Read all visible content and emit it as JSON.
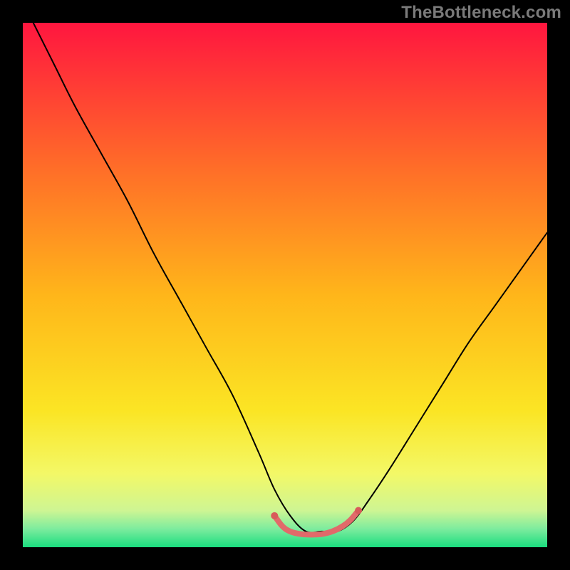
{
  "watermark": "TheBottleneck.com",
  "chart_data": {
    "type": "line",
    "title": "",
    "xlabel": "",
    "ylabel": "",
    "xlim": [
      0,
      100
    ],
    "ylim": [
      0,
      100
    ],
    "grid": false,
    "legend": false,
    "background_gradient": {
      "type": "linear-vertical",
      "stops": [
        {
          "pos": 0.0,
          "color": "#ff163f"
        },
        {
          "pos": 0.28,
          "color": "#ff6e28"
        },
        {
          "pos": 0.52,
          "color": "#ffb61a"
        },
        {
          "pos": 0.74,
          "color": "#fbe524"
        },
        {
          "pos": 0.86,
          "color": "#f3f867"
        },
        {
          "pos": 0.93,
          "color": "#cef593"
        },
        {
          "pos": 0.965,
          "color": "#7dec9e"
        },
        {
          "pos": 1.0,
          "color": "#1add7f"
        }
      ]
    },
    "series": [
      {
        "name": "curve",
        "stroke": "#000000",
        "stroke_width": 2,
        "fill": null,
        "x": [
          2,
          6,
          10,
          15,
          20,
          25,
          30,
          35,
          40,
          45,
          48,
          51,
          54,
          57,
          60,
          63,
          66,
          70,
          75,
          80,
          85,
          90,
          95,
          100
        ],
        "y": [
          100,
          92,
          84,
          75,
          66,
          56,
          47,
          38,
          29,
          18,
          11,
          6,
          3,
          3,
          3,
          5,
          9,
          15,
          23,
          31,
          39,
          46,
          53,
          60
        ]
      },
      {
        "name": "valley-marker",
        "stroke": "#e16a6a",
        "stroke_width": 8,
        "fill": null,
        "x": [
          48,
          49.5,
          51,
          53,
          55,
          57,
          59,
          61,
          62.5,
          64
        ],
        "y": [
          6,
          4,
          3,
          2.5,
          2.4,
          2.5,
          3,
          4,
          5.2,
          7
        ]
      }
    ],
    "valley_dots": {
      "color": "#d85a5a",
      "radius": 5,
      "points": [
        {
          "x": 48.0,
          "y": 6.0
        },
        {
          "x": 64.0,
          "y": 7.0
        }
      ]
    }
  }
}
